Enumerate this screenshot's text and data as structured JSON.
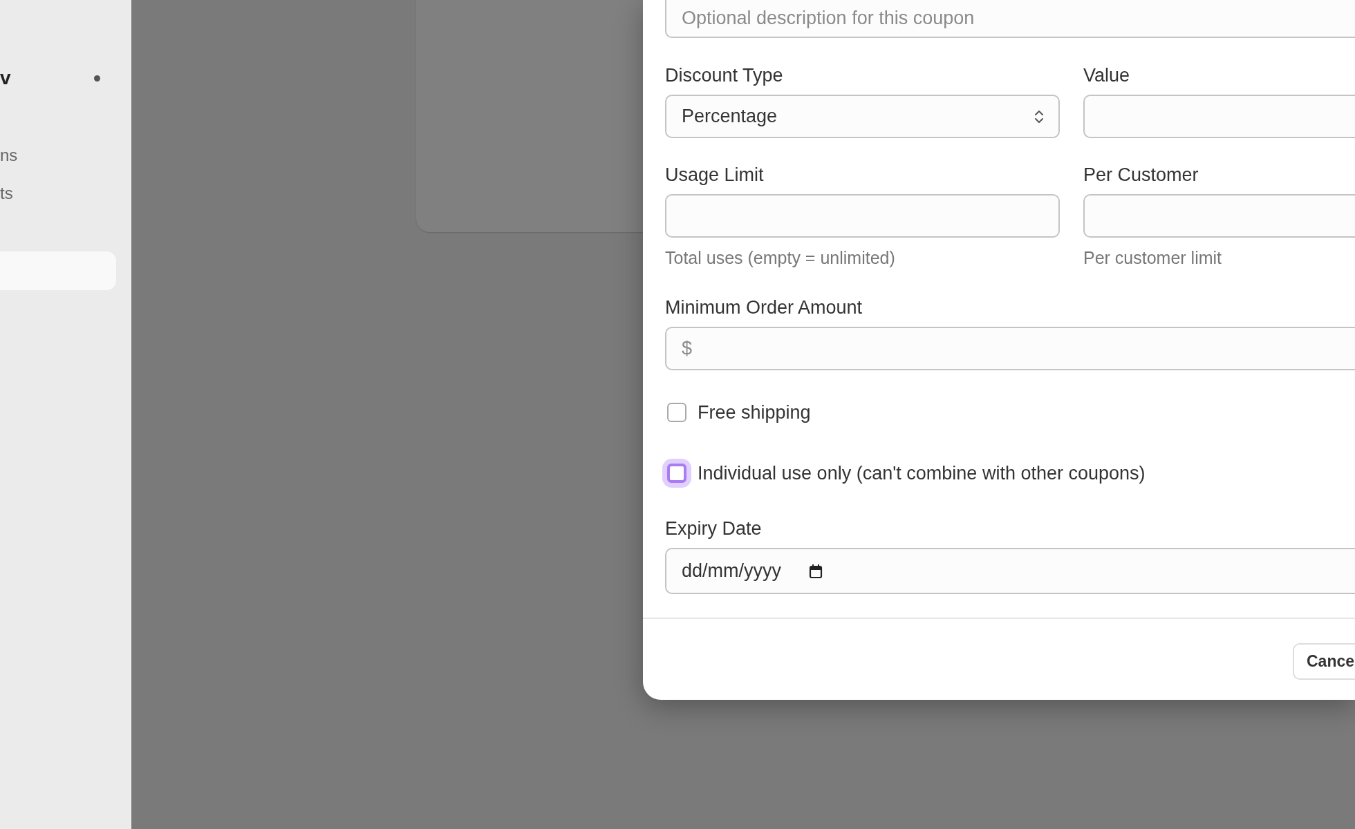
{
  "sidebar": {
    "items": [
      {
        "label": "v",
        "kind": "heading",
        "selected": false
      },
      {
        "label": "ns",
        "kind": "link",
        "selected": false
      },
      {
        "label": "ts",
        "kind": "link",
        "selected": false
      },
      {
        "selected": true
      }
    ]
  },
  "coupon_form": {
    "description": {
      "placeholder": "Optional description for this coupon"
    },
    "discount_type": {
      "label": "Discount Type",
      "value": "Percentage"
    },
    "value": {
      "label": "Value"
    },
    "usage_limit": {
      "label": "Usage Limit",
      "hint": "Total uses (empty = unlimited)"
    },
    "per_customer": {
      "label": "Per Customer",
      "hint": "Per customer limit"
    },
    "minimum_order": {
      "label": "Minimum Order Amount",
      "prefix": "$"
    },
    "checkboxes": [
      {
        "label": "Free shipping",
        "checked": false,
        "focused": false
      },
      {
        "label": "Individual use only (can't combine with other coupons)",
        "checked": false,
        "focused": true
      }
    ],
    "expiry_date": {
      "label": "Expiry Date",
      "placeholder": "dd/mm/yyyy"
    },
    "buttons": [
      {
        "label": "Cance"
      }
    ]
  }
}
